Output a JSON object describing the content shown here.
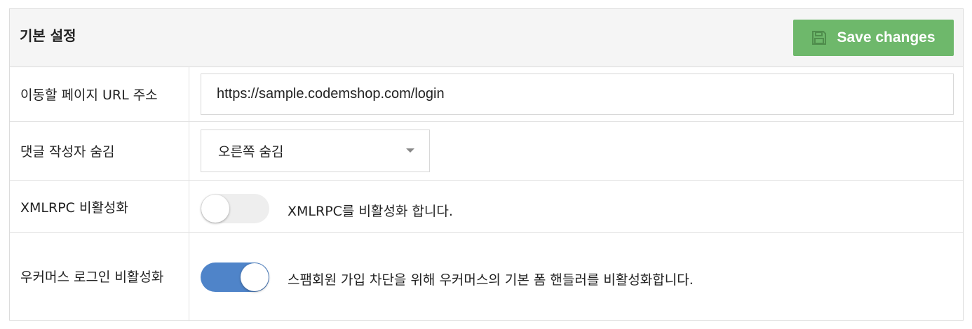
{
  "header": {
    "title": "기본 설정",
    "save_label": "Save changes"
  },
  "colors": {
    "save_button": "#6eb86b",
    "toggle_on": "#4f84c9",
    "toggle_off": "#eeeeee"
  },
  "rows": [
    {
      "label": "이동할 페이지 URL 주소",
      "input_value": "https://sample.codemshop.com/login"
    },
    {
      "label": "댓글 작성자 숨김",
      "selected_option": "오른쪽 숨김"
    },
    {
      "label": "XMLRPC 비활성화",
      "toggle_on": false,
      "description": "XMLRPC를 비활성화 합니다."
    },
    {
      "label": "우커머스 로그인 비활성화",
      "toggle_on": true,
      "description": "스팸회원 가입 차단을 위해 우커머스의 기본 폼 핸들러를 비활성화합니다."
    }
  ]
}
